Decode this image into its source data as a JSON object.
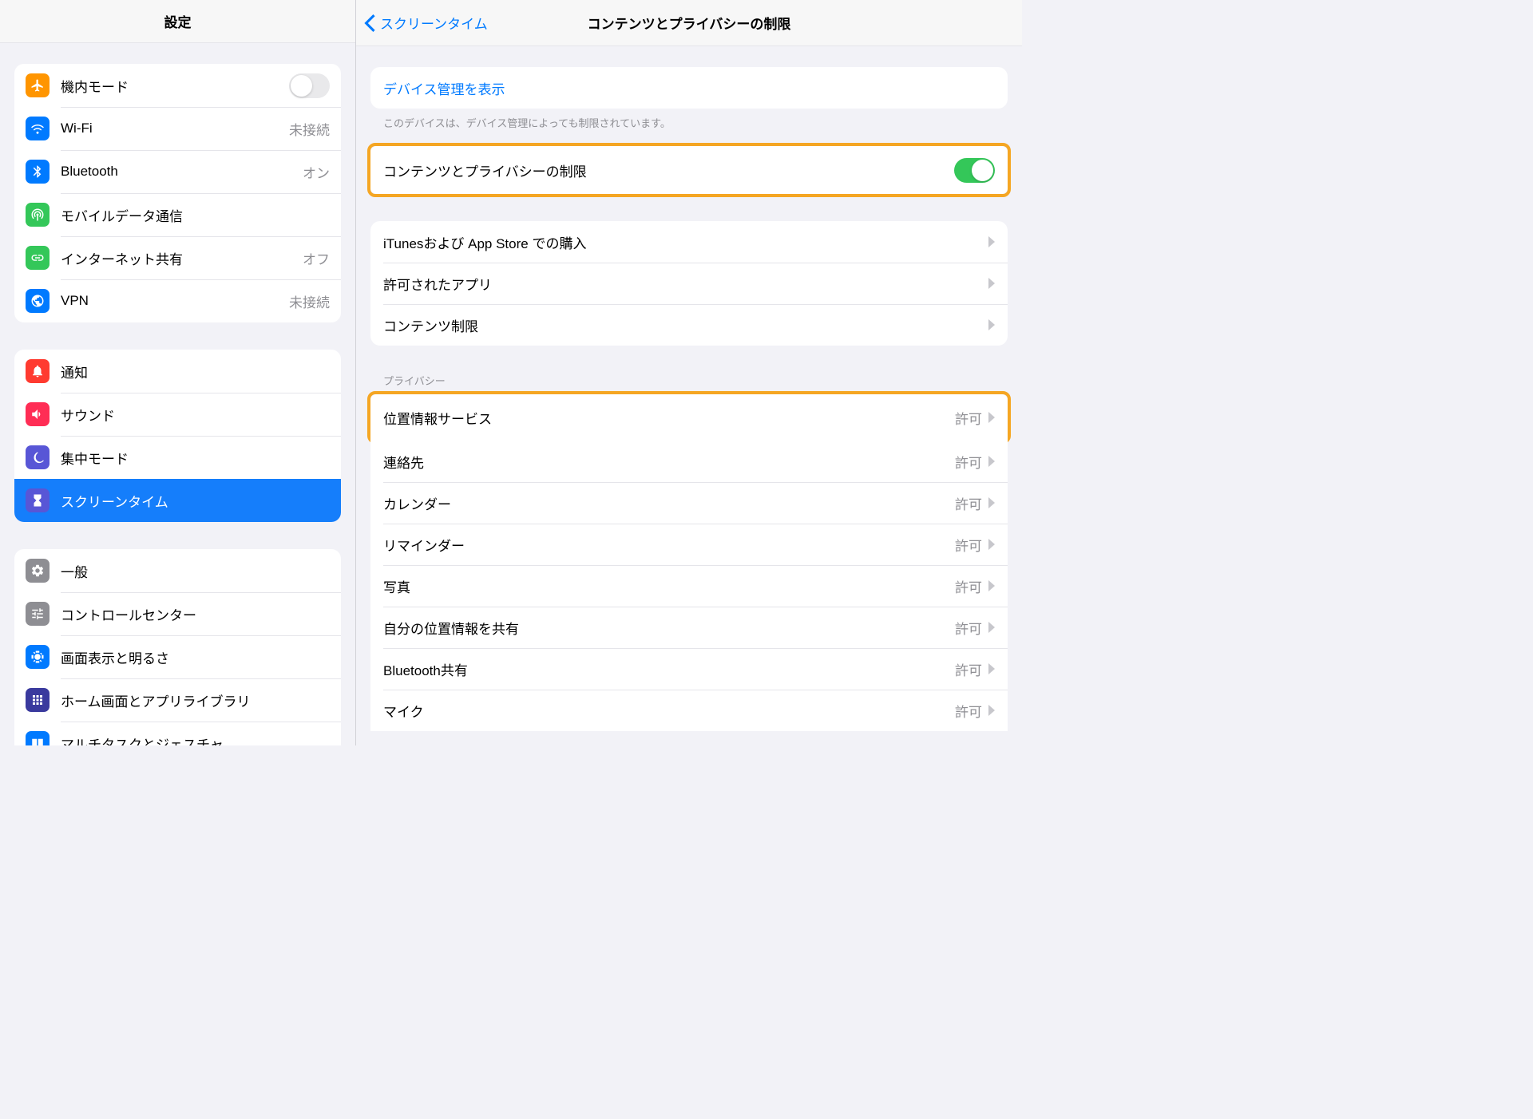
{
  "sidebar": {
    "title": "設定",
    "groups": [
      {
        "items": [
          {
            "label": "機内モード",
            "value": "",
            "toggle": false
          },
          {
            "label": "Wi-Fi",
            "value": "未接続"
          },
          {
            "label": "Bluetooth",
            "value": "オン"
          },
          {
            "label": "モバイルデータ通信",
            "value": ""
          },
          {
            "label": "インターネット共有",
            "value": "オフ"
          },
          {
            "label": "VPN",
            "value": "未接続"
          }
        ]
      },
      {
        "items": [
          {
            "label": "通知",
            "value": ""
          },
          {
            "label": "サウンド",
            "value": ""
          },
          {
            "label": "集中モード",
            "value": ""
          },
          {
            "label": "スクリーンタイム",
            "value": "",
            "selected": true
          }
        ]
      },
      {
        "items": [
          {
            "label": "一般",
            "value": ""
          },
          {
            "label": "コントロールセンター",
            "value": ""
          },
          {
            "label": "画面表示と明るさ",
            "value": ""
          },
          {
            "label": "ホーム画面とアプリライブラリ",
            "value": ""
          },
          {
            "label": "マルチタスクとジェスチャ",
            "value": ""
          }
        ]
      }
    ]
  },
  "main": {
    "back": "スクリーンタイム",
    "title": "コンテンツとプライバシーの制限",
    "device_mgmt_link": "デバイス管理を表示",
    "device_mgmt_note": "このデバイスは、デバイス管理によっても制限されています。",
    "restrict_label": "コンテンツとプライバシーの制限",
    "group2": [
      "iTunesおよび App Store での購入",
      "許可されたアプリ",
      "コンテンツ制限"
    ],
    "privacy_header": "プライバシー",
    "privacy_items": [
      {
        "label": "位置情報サービス",
        "value": "許可",
        "highlight": true
      },
      {
        "label": "連絡先",
        "value": "許可"
      },
      {
        "label": "カレンダー",
        "value": "許可"
      },
      {
        "label": "リマインダー",
        "value": "許可"
      },
      {
        "label": "写真",
        "value": "許可"
      },
      {
        "label": "自分の位置情報を共有",
        "value": "許可"
      },
      {
        "label": "Bluetooth共有",
        "value": "許可"
      },
      {
        "label": "マイク",
        "value": "許可"
      }
    ]
  }
}
